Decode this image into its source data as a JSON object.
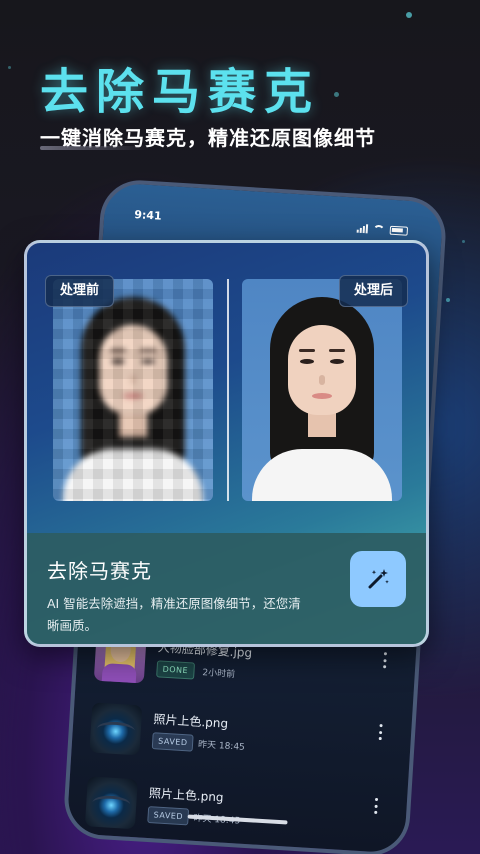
{
  "hero": {
    "title": "去除马赛克",
    "subtitle": "一键消除马赛克，精准还原图像细节"
  },
  "phone": {
    "status_time": "9:41",
    "history": [
      {
        "title": "人物脸部修复.jpg",
        "badge": "DONE",
        "time": "2小时前",
        "thumb": "portrait-thumbnail"
      },
      {
        "title": "照片上色.png",
        "badge": "SAVED",
        "time": "昨天 18:45",
        "thumb": "eye-thumbnail"
      },
      {
        "title": "照片上色.png",
        "badge": "SAVED",
        "time": "昨天 18:45",
        "thumb": "eye-thumbnail"
      }
    ]
  },
  "card": {
    "before_label": "处理前",
    "after_label": "处理后",
    "feature_title": "去除马赛克",
    "feature_desc": "AI 智能去除遮挡，精准还原图像细节，还您清晰画质。",
    "action_icon": "magic-wand-icon"
  },
  "colors": {
    "accent": "#5ce1ee",
    "button": "#8ec9ff",
    "info_panel": "#2c5c62"
  }
}
